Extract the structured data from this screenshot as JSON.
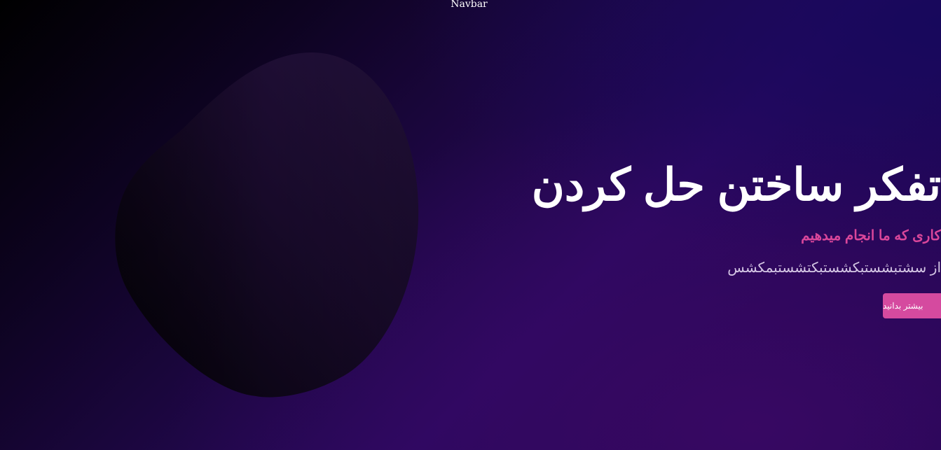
{
  "navbar": {
    "label": "Navbar"
  },
  "hero": {
    "title": "تفکر ساختن حل کردن",
    "subtitle": "کاری که ما انجام میدهیم",
    "description": "از سشتبشستبکشستبکتشستبمکشس",
    "cta_label": "بیشتر بدانید"
  },
  "colors": {
    "accent": "#d54a9f",
    "subtitle": "#d9469a",
    "title": "#ffffff",
    "description": "#d4c6e4",
    "background_dark": "#000000",
    "background_purple": "#2a0860"
  }
}
